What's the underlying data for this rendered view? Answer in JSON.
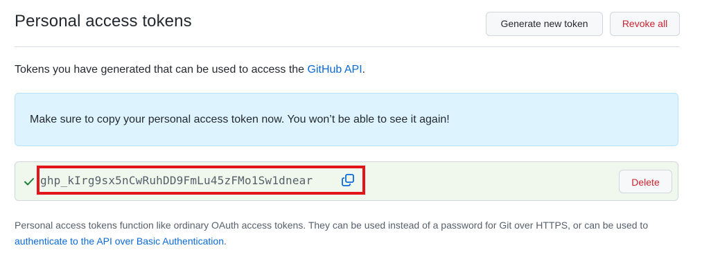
{
  "header": {
    "title": "Personal access tokens",
    "generate_label": "Generate new token",
    "revoke_label": "Revoke all"
  },
  "intro": {
    "text": "Tokens you have generated that can be used to access the ",
    "link": "GitHub API",
    "suffix": "."
  },
  "flash": {
    "message": "Make sure to copy your personal access token now. You won’t be able to see it again!"
  },
  "token": {
    "value": "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",
    "delete_label": "Delete",
    "check_icon": "check-icon",
    "copy_icon": "copy-icon"
  },
  "footer": {
    "text": "Personal access tokens function like ordinary OAuth access tokens. They can be used instead of a password for Git over HTTPS, or can be used to ",
    "link": "authenticate to the API over Basic Authentication",
    "suffix": "."
  },
  "colors": {
    "link": "#0969da",
    "danger": "#cf222e",
    "flash_bg": "#ddf4ff",
    "token_bg": "#f0f8ee",
    "success": "#1a7f37",
    "highlight": "#e4141b"
  }
}
